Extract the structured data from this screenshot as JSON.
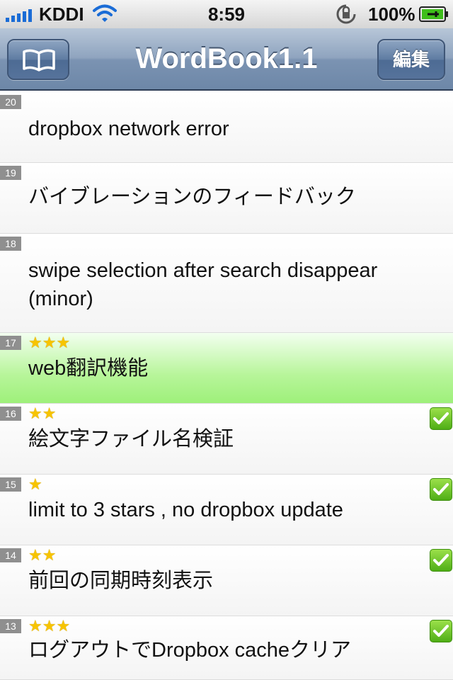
{
  "status_bar": {
    "carrier": "KDDI",
    "time": "8:59",
    "battery_percent": "100%",
    "icons": [
      "signal-icon",
      "wifi-icon",
      "rotation-lock-icon",
      "battery-charging-icon"
    ]
  },
  "nav": {
    "title": "WordBook1.1",
    "left_button_icon": "book-icon",
    "edit_label": "編集"
  },
  "rows": [
    {
      "number": "20",
      "stars": 0,
      "text": "dropbox network error",
      "checked": false,
      "highlighted": false
    },
    {
      "number": "19",
      "stars": 0,
      "text": "バイブレーションのフィードバック",
      "checked": false,
      "highlighted": false
    },
    {
      "number": "18",
      "stars": 0,
      "text": "swipe selection after search disappear (minor)",
      "checked": false,
      "highlighted": false
    },
    {
      "number": "17",
      "stars": 3,
      "text": "web翻訳機能",
      "checked": false,
      "highlighted": true
    },
    {
      "number": "16",
      "stars": 2,
      "text": "絵文字ファイル名検証",
      "checked": true,
      "highlighted": false
    },
    {
      "number": "15",
      "stars": 1,
      "text": "limit to 3 stars , no dropbox update",
      "checked": true,
      "highlighted": false
    },
    {
      "number": "14",
      "stars": 2,
      "text": "前回の同期時刻表示",
      "checked": true,
      "highlighted": false
    },
    {
      "number": "13",
      "stars": 3,
      "text": "ログアウトでDropbox cacheクリア",
      "checked": true,
      "highlighted": false
    }
  ],
  "colors": {
    "nav_gradient_top": "#b7c6d8",
    "nav_gradient_bottom": "#6d87a8",
    "highlight": "#9ef07a",
    "star": "#f7c400",
    "check": "#4fae16",
    "number_badge": "#8f8f8f"
  }
}
